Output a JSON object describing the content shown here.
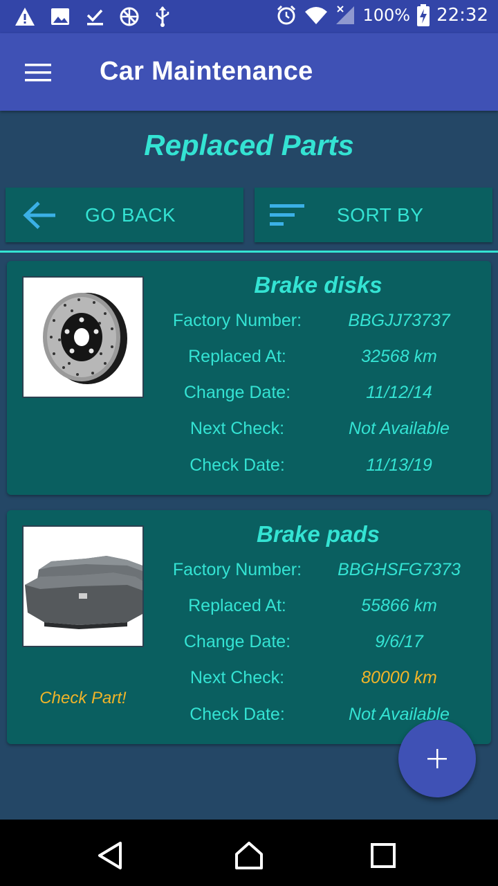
{
  "status_bar": {
    "battery": "100%",
    "time": "22:32",
    "left_icons": [
      "warning-icon",
      "image-icon",
      "download-done-icon",
      "globe-icon",
      "usb-icon"
    ],
    "right_icons": [
      "alarm-icon",
      "wifi-icon",
      "signal-icon",
      "battery-charging-icon"
    ]
  },
  "app_bar": {
    "title": "Car Maintenance",
    "menu_icon": "hamburger-menu-icon"
  },
  "page": {
    "title": "Replaced Parts"
  },
  "buttons": {
    "go_back": "GO BACK",
    "sort_by": "SORT BY"
  },
  "parts": [
    {
      "name": "Brake disks",
      "rows": [
        {
          "label": "Factory Number:",
          "value": "BBGJJ73737"
        },
        {
          "label": "Replaced At:",
          "value": "32568 km"
        },
        {
          "label": "Change Date:",
          "value": "11/12/14"
        },
        {
          "label": "Next Check:",
          "value": "Not Available"
        },
        {
          "label": "Check Date:",
          "value": "11/13/19"
        }
      ],
      "warning": ""
    },
    {
      "name": "Brake pads",
      "rows": [
        {
          "label": "Factory Number:",
          "value": "BBGHSFG7373"
        },
        {
          "label": "Replaced At:",
          "value": "55866 km"
        },
        {
          "label": "Change Date:",
          "value": "9/6/17"
        },
        {
          "label": "Next Check:",
          "value": "80000 km"
        },
        {
          "label": "Check Date:",
          "value": "Not Available"
        }
      ],
      "warning": "Check Part!"
    }
  ],
  "colors": {
    "accent": "#34e3d3",
    "warning": "#f0b429",
    "primary": "#3f51b5",
    "card": "#0a5f60",
    "background": "#244766"
  }
}
